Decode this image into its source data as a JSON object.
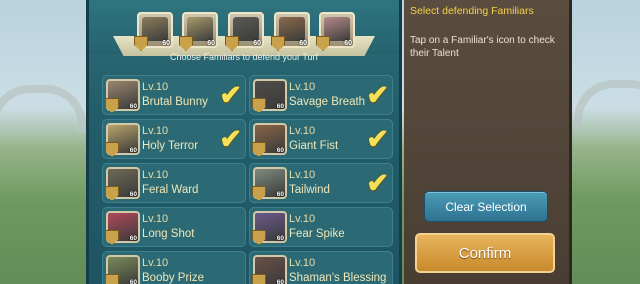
{
  "selected_slots": [
    {
      "level": "60",
      "portrait_color": "#8b7d5a"
    },
    {
      "level": "60",
      "portrait_color": "#a89a6a"
    },
    {
      "level": "60",
      "portrait_color": "#5b5a55"
    },
    {
      "level": "60",
      "portrait_color": "#8a6a4a"
    },
    {
      "level": "60",
      "portrait_color": "#b58a8a"
    }
  ],
  "choose_caption": "Choose Familiars to defend your Turf",
  "familiars": [
    {
      "level": "Lv.10",
      "name": "Brutal Bunny",
      "badge": "60",
      "checked": true,
      "portrait_color": "#9a8670"
    },
    {
      "level": "Lv.10",
      "name": "Savage Breath",
      "badge": "60",
      "checked": true,
      "portrait_color": "#4f4d48"
    },
    {
      "level": "Lv.10",
      "name": "Holy Terror",
      "badge": "60",
      "checked": true,
      "portrait_color": "#b8a36a"
    },
    {
      "level": "Lv.10",
      "name": "Giant Fist",
      "badge": "60",
      "checked": true,
      "portrait_color": "#8a6448"
    },
    {
      "level": "Lv.10",
      "name": "Feral Ward",
      "badge": "60",
      "checked": false,
      "portrait_color": "#6e6a55"
    },
    {
      "level": "Lv.10",
      "name": "Tailwind",
      "badge": "60",
      "checked": true,
      "portrait_color": "#7f8a7e"
    },
    {
      "level": "Lv.10",
      "name": "Long Shot",
      "badge": "60",
      "checked": false,
      "portrait_color": "#b04a5a"
    },
    {
      "level": "Lv.10",
      "name": "Fear Spike",
      "badge": "60",
      "checked": false,
      "portrait_color": "#6a5a8a"
    },
    {
      "level": "Lv.10",
      "name": "Booby Prize",
      "badge": "60",
      "checked": false,
      "portrait_color": "#7a8a5a"
    },
    {
      "level": "Lv.10",
      "name": "Shaman's Blessing",
      "badge": "60",
      "checked": false,
      "portrait_color": "#6a5048"
    }
  ],
  "side": {
    "title": "Select defending Familiars",
    "description": "Tap on a Familiar's icon to check their Talent",
    "clear_label": "Clear Selection",
    "confirm_label": "Confirm"
  },
  "colors": {
    "accent": "#f5d04a",
    "check": "#f6e05a",
    "panel": "#235d6a"
  },
  "icons": {
    "check": "check-mark-icon",
    "shield": "shield-badge-icon"
  }
}
